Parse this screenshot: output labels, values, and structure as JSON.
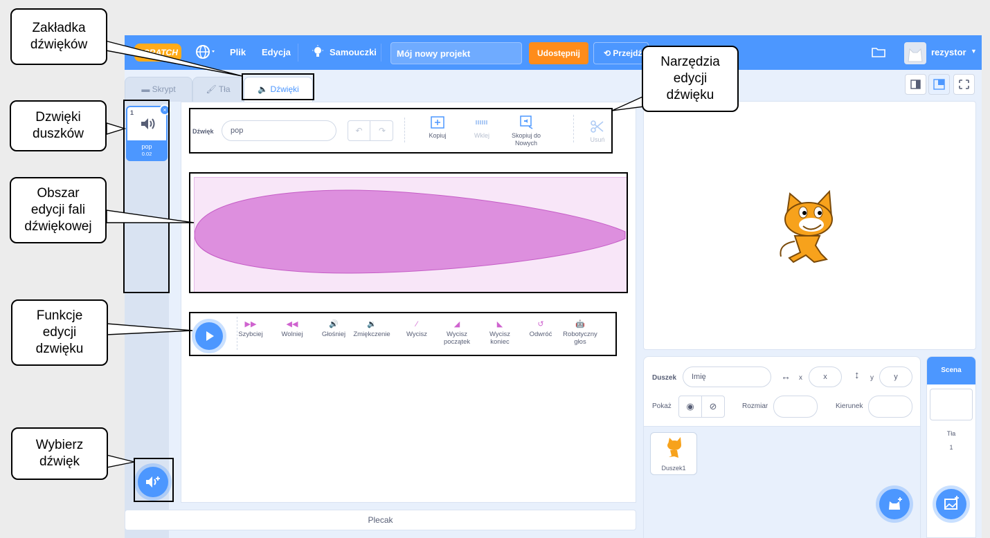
{
  "menubar": {
    "logo": "SCRATCH",
    "file": "Plik",
    "edit": "Edycja",
    "tutorials": "Samouczki",
    "project_title": "Mój nowy projekt",
    "share": "Udostępnij",
    "see_project": "Przejdź",
    "username": "rezystor"
  },
  "tabs": {
    "code": "Skrypt",
    "backdrops": "Tła",
    "sounds": "Dźwięki"
  },
  "sound_list": [
    {
      "index": "1",
      "name": "pop",
      "duration": "0.02"
    }
  ],
  "editor": {
    "sound_label": "Dźwięk",
    "sound_name": "pop",
    "tools": {
      "copy": "Kopiuj",
      "paste": "Wklej",
      "copy_new_1": "Skopiuj do",
      "copy_new_2": "Nowych",
      "delete": "Usuń"
    },
    "effects": [
      {
        "l1": "Szybciej",
        "l2": ""
      },
      {
        "l1": "Wolniej",
        "l2": ""
      },
      {
        "l1": "Głośniej",
        "l2": ""
      },
      {
        "l1": "Zmiękczenie",
        "l2": ""
      },
      {
        "l1": "Wycisz",
        "l2": ""
      },
      {
        "l1": "Wycisz",
        "l2": "początek"
      },
      {
        "l1": "Wycisz",
        "l2": "koniec"
      },
      {
        "l1": "Odwróć",
        "l2": ""
      },
      {
        "l1": "Robotyczny",
        "l2": "głos"
      }
    ]
  },
  "backpack": "Plecak",
  "sprite_info": {
    "sprite_label": "Duszek",
    "name_placeholder": "Imię",
    "x_label": "x",
    "x_placeholder": "x",
    "y_label": "y",
    "y_placeholder": "y",
    "show_label": "Pokaż",
    "size_label": "Rozmiar",
    "direction_label": "Kierunek",
    "sprite_name": "Duszek1"
  },
  "scene": {
    "title": "Scena",
    "backdrops_label": "Tła",
    "backdrop_count": "1"
  },
  "annotations": {
    "sounds_tab": [
      "Zakładka",
      "dźwięków"
    ],
    "sprite_sounds": [
      "Dzwięki",
      "duszków"
    ],
    "wave_area": [
      "Obszar",
      "edycji fali",
      "dźwiękowej"
    ],
    "functions": [
      "Funkcje",
      "edycji",
      "dzwięku"
    ],
    "choose_sound": [
      "Wybierz",
      "dźwięk"
    ],
    "tools": [
      "Narzędzia",
      "edycji",
      "dźwięku"
    ]
  },
  "colors": {
    "accent": "#4c97ff",
    "orange": "#ff8c1a",
    "sound": "#cf63cf"
  }
}
